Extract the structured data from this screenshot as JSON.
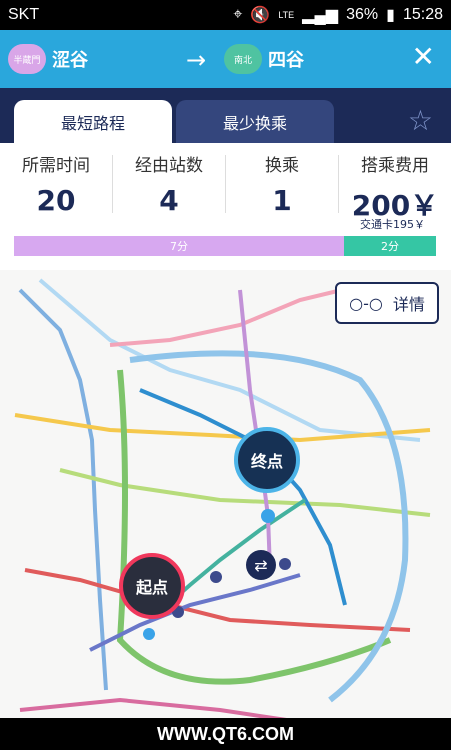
{
  "statusbar": {
    "carrier": "SKT",
    "network": "LTE",
    "battery": "36%",
    "time": "15:28"
  },
  "route": {
    "from_badge": "半蔵門",
    "from_station": "涩谷",
    "to_badge": "南北",
    "to_station": "四谷"
  },
  "tabs": {
    "active": "最短路程",
    "inactive": "最少换乘"
  },
  "summary": {
    "time_label": "所需时间",
    "time_value": "20",
    "stations_label": "经由站数",
    "stations_value": "4",
    "transfers_label": "换乘",
    "transfers_value": "1",
    "fare_label": "搭乘费用",
    "fare_value": "200￥",
    "card_fare": "交通卡195￥"
  },
  "progress": {
    "seg1": "7分",
    "seg2": "2分"
  },
  "map": {
    "detail_label": "详情",
    "end_label": "终点",
    "start_label": "起点"
  },
  "watermark": "WWW.QT6.COM"
}
